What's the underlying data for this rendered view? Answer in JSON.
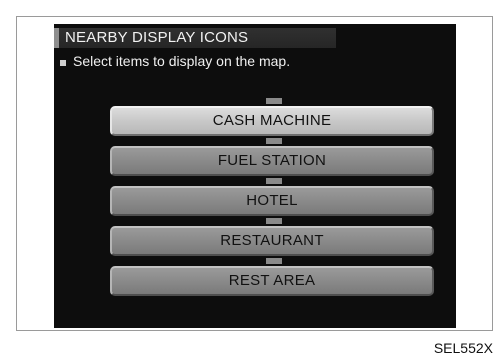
{
  "screen": {
    "title": "NEARBY DISPLAY ICONS",
    "instruction": "Select items to display on the map.",
    "items": [
      {
        "label": "CASH MACHINE",
        "selected": true
      },
      {
        "label": "FUEL STATION",
        "selected": false
      },
      {
        "label": "HOTEL",
        "selected": false
      },
      {
        "label": "RESTAURANT",
        "selected": false
      },
      {
        "label": "REST AREA",
        "selected": false
      }
    ]
  },
  "figure_code": "SEL552X"
}
